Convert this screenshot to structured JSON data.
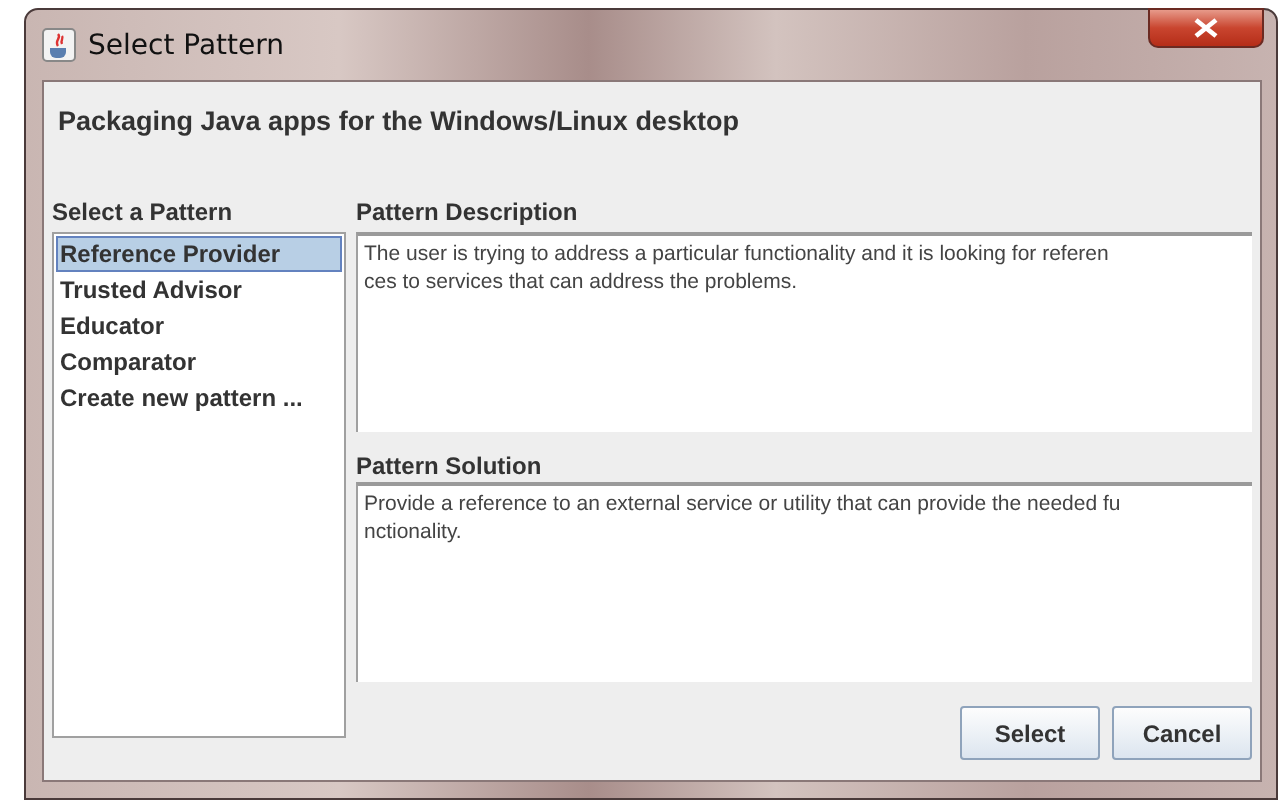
{
  "window": {
    "title": "Select Pattern"
  },
  "heading": "Packaging Java apps for the Windows/Linux desktop",
  "patterns": {
    "label": "Select a Pattern",
    "items": [
      {
        "label": "Reference Provider",
        "selected": true
      },
      {
        "label": "Trusted Advisor",
        "selected": false
      },
      {
        "label": "Educator",
        "selected": false
      },
      {
        "label": "Comparator",
        "selected": false
      },
      {
        "label": "Create new pattern ...",
        "selected": false
      }
    ]
  },
  "description": {
    "label": "Pattern Description",
    "lines": [
      "The user is trying to address a particular functionality and it is looking for referen",
      "ces to services that can address the problems."
    ]
  },
  "solution": {
    "label": "Pattern Solution",
    "lines": [
      "Provide a reference to an external service or utility that can provide the needed fu",
      "nctionality."
    ]
  },
  "buttons": [
    "Select",
    "Cancel"
  ]
}
